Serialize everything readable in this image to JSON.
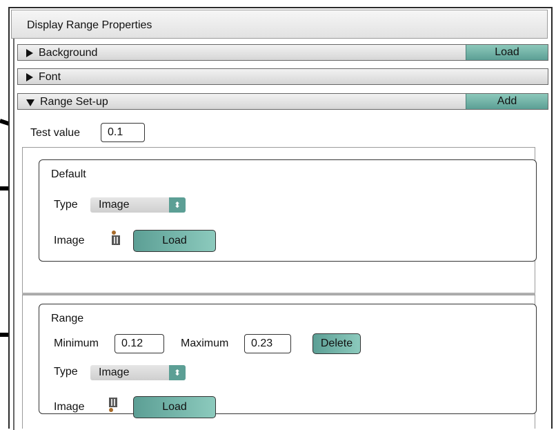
{
  "panel": {
    "title": "Display Range Properties"
  },
  "sections": {
    "background": {
      "label": "Background",
      "button": "Load"
    },
    "font": {
      "label": "Font"
    },
    "range_setup": {
      "label": "Range Set-up",
      "button": "Add"
    }
  },
  "test_value": {
    "label": "Test value",
    "value": "0.1"
  },
  "default_group": {
    "title": "Default",
    "type_label": "Type",
    "type_value": "Image",
    "image_label": "Image",
    "load_button": "Load"
  },
  "range_group": {
    "title": "Range",
    "min_label": "Minimum",
    "min_value": "0.12",
    "max_label": "Maximum",
    "max_value": "0.23",
    "delete_button": "Delete",
    "type_label": "Type",
    "type_value": "Image",
    "image_label": "Image",
    "load_button": "Load"
  },
  "icons": {
    "collapsed": "triangle-right-icon",
    "expanded": "triangle-down-icon",
    "select": "up-down-arrows-icon",
    "image": "image-thumbnail-icon",
    "pointer": "black-arrow-icon"
  }
}
